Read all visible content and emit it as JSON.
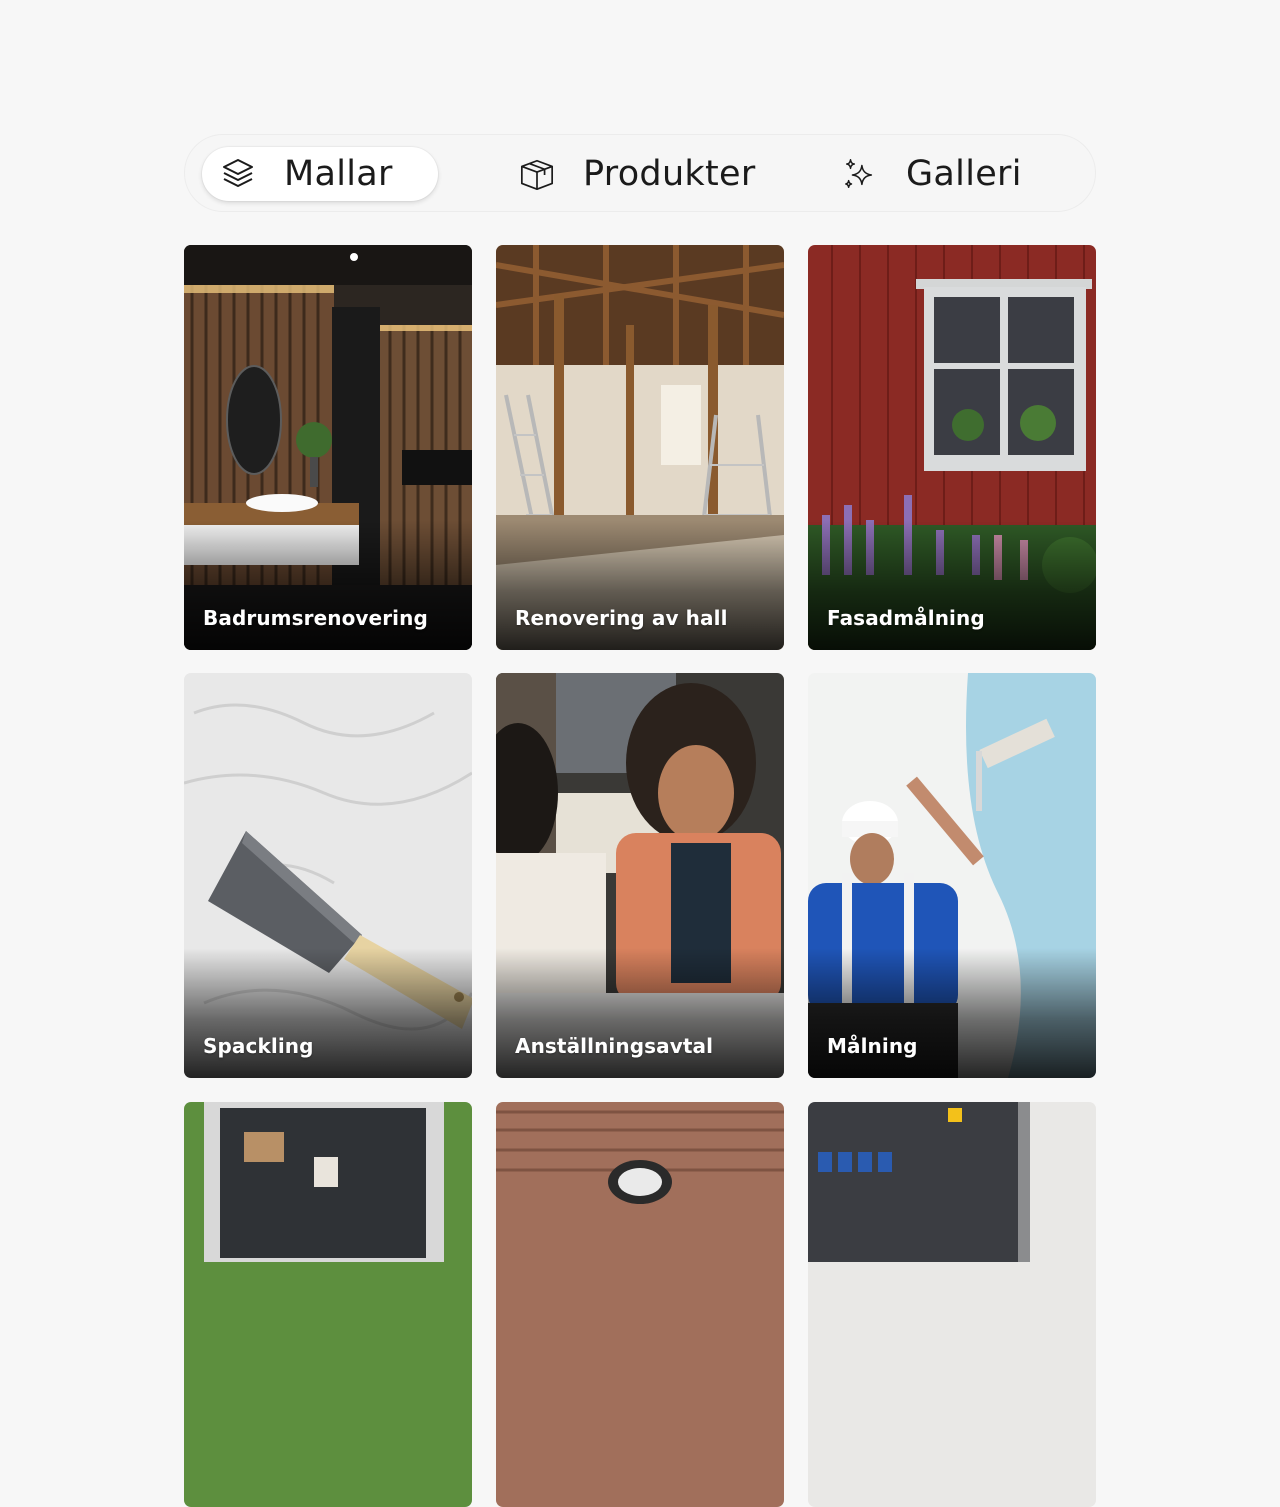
{
  "tabs": [
    {
      "label": "Mallar",
      "icon": "layers-icon",
      "active": true
    },
    {
      "label": "Produkter",
      "icon": "package-icon",
      "active": false
    },
    {
      "label": "Galleri",
      "icon": "sparkles-icon",
      "active": false
    }
  ],
  "cards": [
    {
      "title": "Badrumsrenovering"
    },
    {
      "title": "Renovering av hall"
    },
    {
      "title": "Fasadmålning"
    },
    {
      "title": "Spackling"
    },
    {
      "title": "Anställningsavtal"
    },
    {
      "title": "Målning"
    }
  ],
  "colors": {
    "background": "#f7f7f7",
    "text": "#1b1b1b",
    "caption": "#ffffff"
  }
}
